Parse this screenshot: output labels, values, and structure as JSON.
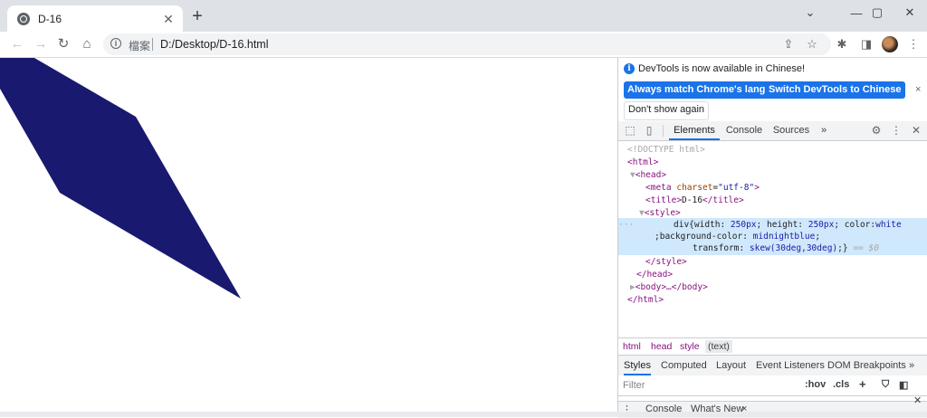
{
  "browser": {
    "tab_title": "D-16",
    "new_tab": "+",
    "omnibox": {
      "security_label": "檔案",
      "url": "D:/Desktop/D-16.html"
    }
  },
  "page": {
    "shape_color": "#191970"
  },
  "devtools": {
    "infobar": {
      "message": "DevTools is now available in Chinese!",
      "btn_match": "Always match Chrome's language",
      "btn_switch": "Switch DevTools to Chinese",
      "btn_dont_show": "Don't show again",
      "close": "×"
    },
    "tabs": [
      "Elements",
      "Console",
      "Sources"
    ],
    "more_tabs": "»",
    "dom": {
      "doctype": "<!DOCTYPE html>",
      "html_open": "<html>",
      "head_open": "<head>",
      "meta": {
        "tag": "meta",
        "attr": "charset",
        "value": "\"utf-8\""
      },
      "title_open": "<title>",
      "title_text": "D-16",
      "title_close": "</title>",
      "style_open": "<style>",
      "ellipsis": "···",
      "style_line1_a": "div{width: ",
      "style_line1_b": "250px",
      "style_line1_c": "; height: ",
      "style_line1_d": "250px",
      "style_line1_e": "; color:",
      "style_line1_f": "white",
      "style_line2_a": ";background-color: ",
      "style_line2_b": "midnightblue",
      "style_line2_c": ";",
      "style_line3_a": "transform: ",
      "style_line3_b": "skew(30deg,30deg)",
      "style_line3_c": ";}",
      "style_line3_d": " == $0",
      "style_close": "</style>",
      "head_close": "</head>",
      "body_collapsed": "<body>…</body>",
      "html_close": "</html>"
    },
    "breadcrumbs": [
      "html",
      "head",
      "style",
      "(text)"
    ],
    "styles_tabs": [
      "Styles",
      "Computed",
      "Layout",
      "Event Listeners",
      "DOM Breakpoints"
    ],
    "styles_more": "»",
    "filter": {
      "placeholder": "Filter",
      "hov": ":hov",
      "cls": ".cls",
      "plus": "+"
    },
    "drawer": {
      "console": "Console",
      "whats_new": "What's New",
      "close": "×"
    }
  }
}
